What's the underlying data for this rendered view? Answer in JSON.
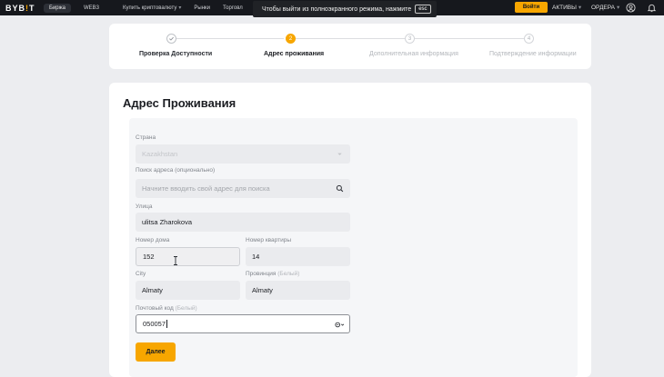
{
  "topbar": {
    "logo": "BYBIT",
    "exchange_pill": "Биржа",
    "web3": "WEB3",
    "buy_crypto": "Купить криптовалюту",
    "markets": "Рынки",
    "trading": "Торговл",
    "login": "Войти",
    "assets": "АКТИВЫ",
    "orders": "ОРДЕРА"
  },
  "fullscreen_toast": {
    "text": "Чтобы выйти из полноэкранного режима, нажмите",
    "key": "esc"
  },
  "stepper": {
    "steps": [
      {
        "label": "Проверка Доступности",
        "number": "",
        "state": "done"
      },
      {
        "label": "Адрес проживания",
        "number": "2",
        "state": "active"
      },
      {
        "label": "Дополнительная информация",
        "number": "3",
        "state": "todo"
      },
      {
        "label": "Подтверждение информации",
        "number": "4",
        "state": "todo"
      }
    ]
  },
  "form": {
    "title": "Адрес Проживания",
    "country_label": "Страна",
    "country_value": "Kazakhstan",
    "search_label": "Поиск адреса (опционально)",
    "search_placeholder": "Начните вводить свой адрес для поиска",
    "street_label": "Улица",
    "street_value": "ulitsa Zharokova",
    "house_label": "Номер дома",
    "house_value": "152",
    "apartment_label": "Номер квартиры",
    "apartment_value": "14",
    "city_label": "City",
    "city_value": "Almaty",
    "province_label": "Провинция",
    "province_hint": "(Белый)",
    "province_value": "Almaty",
    "postal_label": "Почтовый код",
    "postal_hint": "(Белый)",
    "postal_value": "050057",
    "next_button": "Далее"
  },
  "colors": {
    "accent": "#f7a600",
    "topbar": "#16181d",
    "page_bg": "#ecedf0"
  }
}
